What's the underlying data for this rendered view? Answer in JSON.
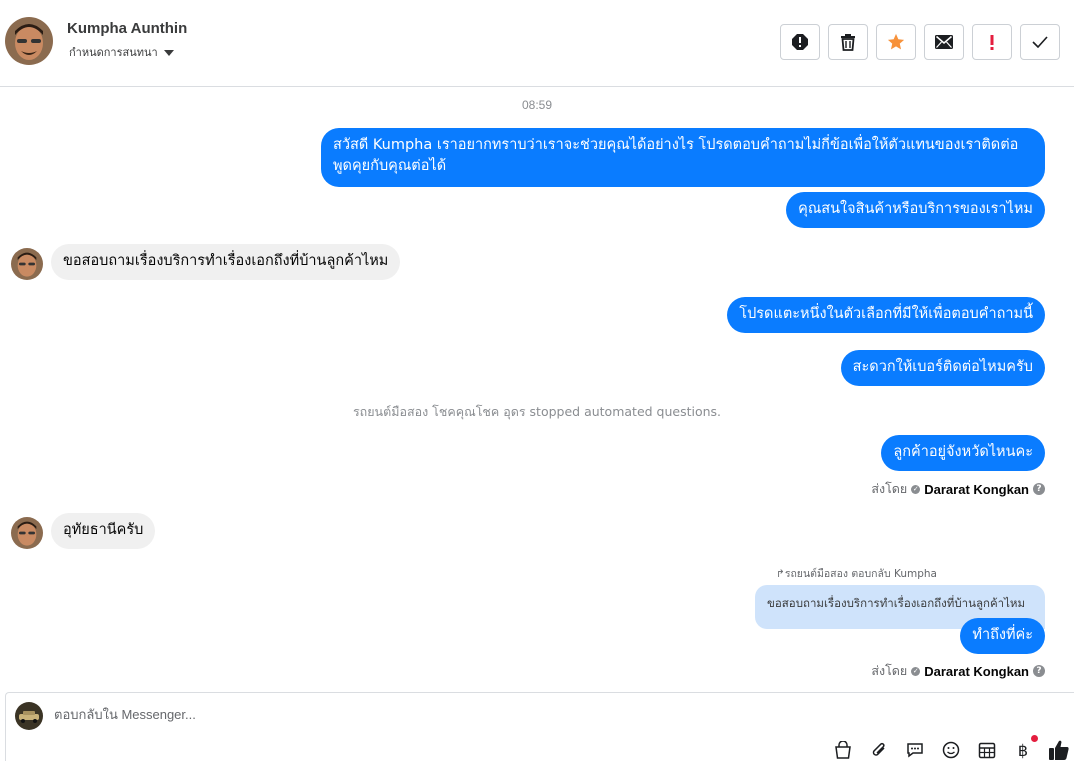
{
  "header": {
    "contact_name": "Kumpha Aunthin",
    "assign_label": "กำหนดการสนทนา",
    "actions": [
      {
        "icon": "spam-report-icon"
      },
      {
        "icon": "trash-icon"
      },
      {
        "icon": "star-icon",
        "color": "#f7923b"
      },
      {
        "icon": "envelope-icon"
      },
      {
        "icon": "exclamation-icon",
        "color": "#e41e3f"
      },
      {
        "icon": "check-icon"
      }
    ]
  },
  "conversation": {
    "timestamp": "08:59",
    "messages": [
      {
        "text": "สวัสดี Kumpha เราอยากทราบว่าเราจะช่วยคุณได้อย่างไร โปรดตอบคำถามไม่กี่ข้อเพื่อให้ตัวแทนของเราติดต่อพูดคุยกับคุณต่อได้"
      },
      {
        "text": "คุณสนใจสินค้าหรือบริการของเราไหม"
      },
      {
        "text": "ขอสอบถามเรื่องบริการทำเรื่องเอกถึงที่บ้านลูกค้าไหม"
      },
      {
        "text": "โปรดแตะหนึ่งในตัวเลือกที่มีให้เพื่อตอบคำถามนี้"
      },
      {
        "text": "สะดวกให้เบอร์ติดต่อไหมครับ"
      },
      {
        "text": "ลูกค้าอยู่จังหวัดไหนคะ"
      },
      {
        "text": "อุทัยธานีครับ"
      },
      {
        "text": "ทำถึงที่ค่ะ"
      }
    ],
    "system_notice": "รถยนต์มือสอง โชคคุณโชค อุดร stopped automated questions.",
    "sent_by_prefix": "ส่งโดย",
    "agent_name": "Dararat Kongkan",
    "reply_label": "รถยนต์มือสอง ตอบกลับ Kumpha",
    "quoted_text": "ขอสอบถามเรื่องบริการทำเรื่องเอกถึงที่บ้านลูกค้าไหม",
    "accent_color": "#0a7cff"
  },
  "composer": {
    "placeholder": "ตอบกลับใน Messenger...",
    "icons": [
      "shopping-bag-icon",
      "paperclip-icon",
      "saved-replies-icon",
      "emoji-icon",
      "appointment-icon",
      "baht-payment-icon",
      "thumbs-up-icon"
    ]
  }
}
